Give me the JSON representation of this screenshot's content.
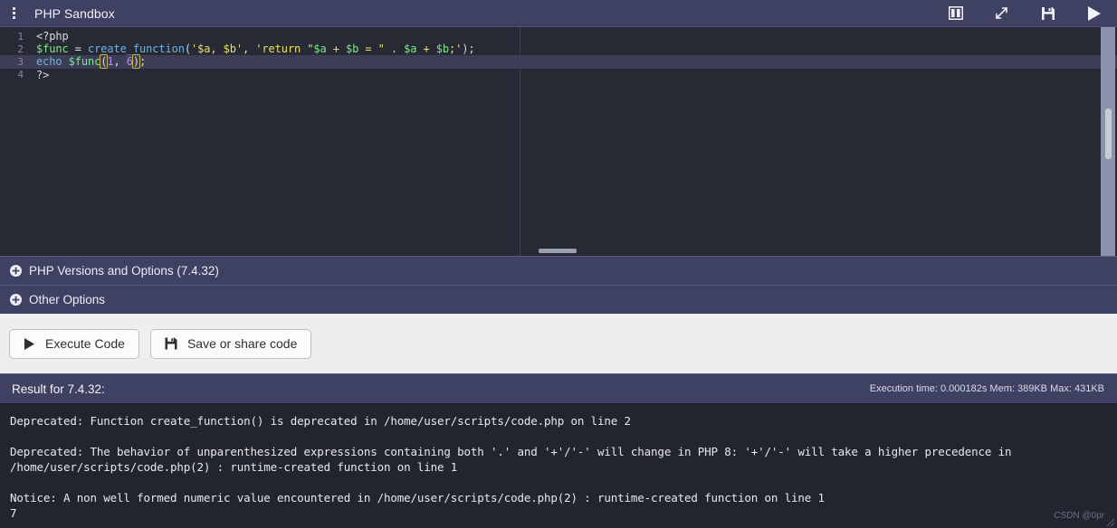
{
  "window": {
    "title": "PHP Sandbox",
    "menu_icon": "kebab-menu-icon",
    "actions": [
      {
        "name": "split-pane-icon",
        "label": "Split pane"
      },
      {
        "name": "expand-icon",
        "label": "Expand"
      },
      {
        "name": "save-icon",
        "label": "Save"
      },
      {
        "name": "run-icon",
        "label": "Run"
      }
    ]
  },
  "editor": {
    "lines": [
      {
        "n": "1",
        "text": "<?php"
      },
      {
        "n": "2",
        "text": "$func = create_function('$a, $b', 'return \"$a + $b = \" . $a + $b;');"
      },
      {
        "n": "3",
        "text": "echo $func(1, 6);"
      },
      {
        "n": "4",
        "text": "?>"
      }
    ],
    "active_line": "3",
    "line_numbers": {
      "l1": "1",
      "l2": "2",
      "l3": "3",
      "l4": "4"
    },
    "tokens": {
      "l1_tag": "<?php",
      "l2_var": "$func",
      "l2_eq": " = ",
      "l2_fn": "create_function",
      "l2_paren_open": "(",
      "l2_str1": "'$a, $b'",
      "l2_comma": ", ",
      "l2_str2a": "'return \"",
      "l2_va": "$a",
      "l2_plus1": " + ",
      "l2_vb": "$b",
      "l2_eqstr": " = ",
      "l2_q": "\" . ",
      "l2_va2": "$a",
      "l2_plus2": " + ",
      "l2_vb2": "$b",
      "l2_tail": ";'",
      "l2_paren_close": ")",
      "l2_semi": ";",
      "l3_kw": "echo ",
      "l3_var": "$func",
      "l3_paren_open": "(",
      "l3_n1": "1",
      "l3_comma": ", ",
      "l3_n2": "6",
      "l3_paren_close": ")",
      "l3_semi": ";",
      "l4_tag": "?>"
    }
  },
  "accordions": [
    {
      "label": "PHP Versions and Options (7.4.32)",
      "icon": "plus-circle-icon",
      "expanded": false
    },
    {
      "label": "Other Options",
      "icon": "plus-circle-icon",
      "expanded": false
    }
  ],
  "buttons": {
    "execute": {
      "label": "Execute Code",
      "icon": "play-icon"
    },
    "save_share": {
      "label": "Save or share code",
      "icon": "save-icon"
    }
  },
  "result": {
    "title": "Result for 7.4.32:",
    "stats": "Execution time: 0.000182s Mem: 389KB Max: 431KB",
    "output_lines": [
      "Deprecated: Function create_function() is deprecated in /home/user/scripts/code.php on line 2",
      "",
      "Deprecated: The behavior of unparenthesized expressions containing both '.' and '+'/'-' will change in PHP 8: '+'/'-' will take a higher precedence in /home/user/scripts/code.php(2) : runtime-created function on line 1",
      "",
      "Notice: A non well formed numeric value encountered in /home/user/scripts/code.php(2) : runtime-created function on line 1",
      "7"
    ]
  },
  "watermark": "CSDN @0pr",
  "colors": {
    "titlebar": "#3e4162",
    "editor_bg": "#272a35",
    "output_bg": "#22252f",
    "panel": "#3e4162",
    "button_bar": "#eeeeee",
    "string": "#e8e06a",
    "variable": "#7ee787",
    "function": "#6fb3e0",
    "number": "#b48cf2"
  }
}
